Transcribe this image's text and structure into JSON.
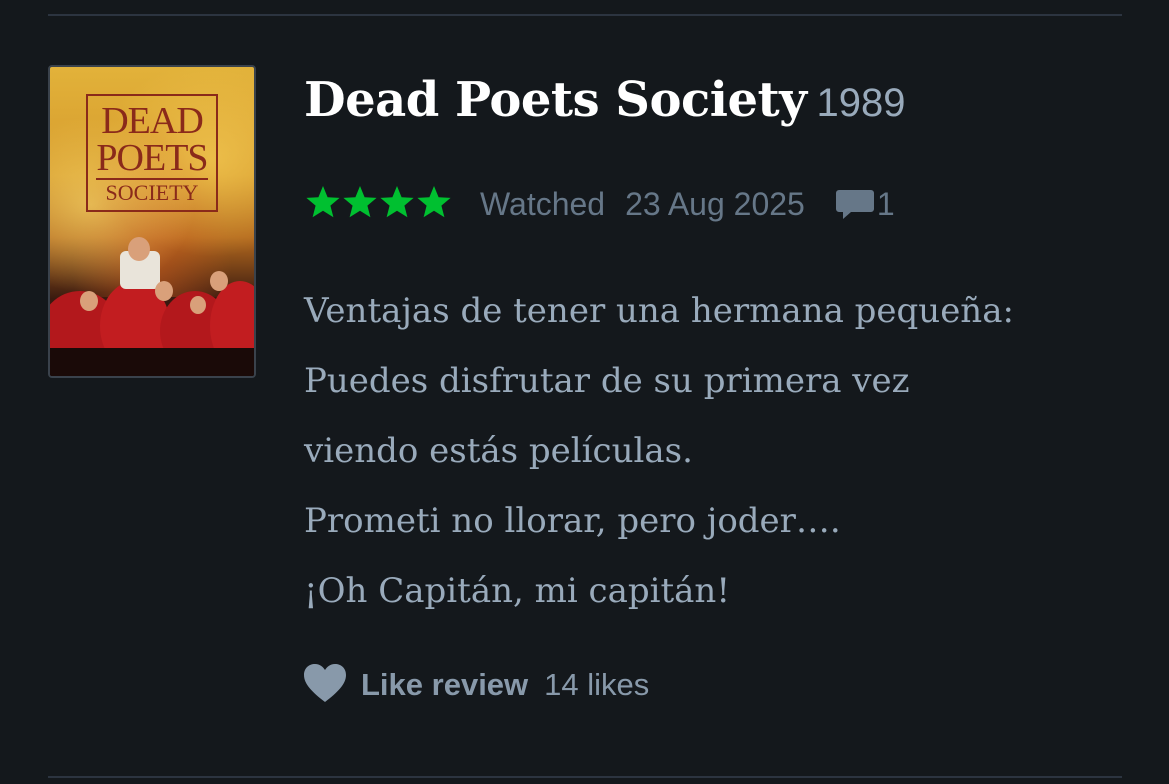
{
  "film": {
    "title": "Dead Poets Society",
    "year": "1989",
    "poster": {
      "icon": "film-poster-image",
      "title_line1": "DEAD",
      "title_line2": "POETS",
      "title_line3": "SOCIETY"
    }
  },
  "meta": {
    "rating_stars": 4,
    "rating_max": 5,
    "star_color": "#00c030",
    "watched_label": "Watched",
    "watched_date": "23 Aug 2025",
    "comment_icon": "comment-bubble-icon",
    "comment_count": "1"
  },
  "review": {
    "lines": [
      "Ventajas de tener una hermana pequeña:",
      "Puedes disfrutar de su primera vez",
      "viendo estás películas.",
      "Prometi no llorar, pero joder….",
      "¡Oh Capitán, mi capitán!"
    ]
  },
  "like": {
    "icon": "heart-icon",
    "label": "Like review",
    "count": "14 likes"
  },
  "colors": {
    "background": "#14181c",
    "divider": "#2c3440",
    "title": "#ffffff",
    "muted": "#99aabb",
    "meta": "#667788",
    "star": "#00c030"
  }
}
